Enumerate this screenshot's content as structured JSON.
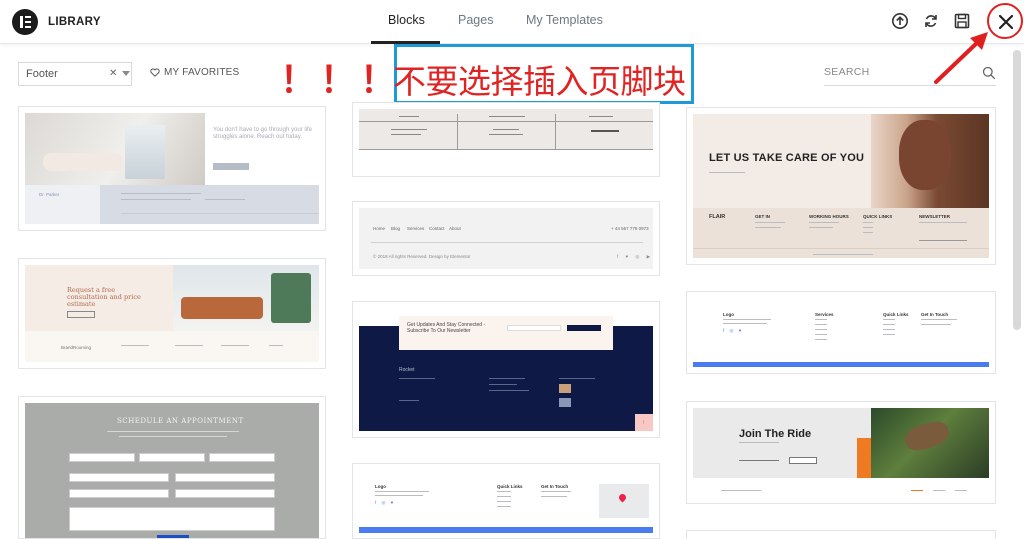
{
  "header": {
    "title": "LIBRARY",
    "tabs": [
      {
        "label": "Blocks",
        "active": true
      },
      {
        "label": "Pages",
        "active": false
      },
      {
        "label": "My Templates",
        "active": false
      }
    ],
    "actions": [
      "upload-icon",
      "sync-icon",
      "save-icon",
      "close-icon"
    ]
  },
  "filter": {
    "category_value": "Footer",
    "favorites_label": "MY FAVORITES",
    "search_placeholder": "SEARCH"
  },
  "annotation": {
    "exclamations": [
      "！",
      "！",
      "！"
    ],
    "text": "不要选择插入页脚块",
    "color": "#e02424",
    "box_color": "#1e9bd7"
  },
  "cards": {
    "c1": {
      "headline": "You don't have to go through your life struggles alone. Reach out today.",
      "brand": "Dr. Parker"
    },
    "c2": {
      "headline": "Request a free consultation and price estimate",
      "brand": "BrandRooming"
    },
    "c3": {
      "headline": "SCHEDULE AN APPOINTMENT"
    },
    "c4": {},
    "c5": {
      "nav": [
        "Home",
        "Blog",
        "Services",
        "Contact",
        "About"
      ],
      "phone": "+ 44 567 778 0973",
      "copy": "© 2018 All rights Reserved. Design by Elementor"
    },
    "c6": {
      "headline": "Get Updates And Stay Connected - Subscribe To Our Newsletter",
      "brand": "Rocket"
    },
    "c7": {
      "cols": [
        "Logo",
        "Quick Links",
        "Get In Touch"
      ]
    },
    "c8": {
      "headline": "LET US TAKE CARE OF YOU",
      "brand": "FLAIR",
      "cols": [
        "GET IN",
        "WORKING HOURS",
        "QUICK LINKS",
        "NEWSLETTER"
      ]
    },
    "c9": {
      "cols": [
        "Logo",
        "Services",
        "Quick Links",
        "Get In Touch"
      ]
    },
    "c10": {
      "headline": "Join The Ride"
    }
  },
  "colors": {
    "accent_blue": "#4a7cf0",
    "navy": "#0e1a45",
    "orange": "#f07a21"
  }
}
